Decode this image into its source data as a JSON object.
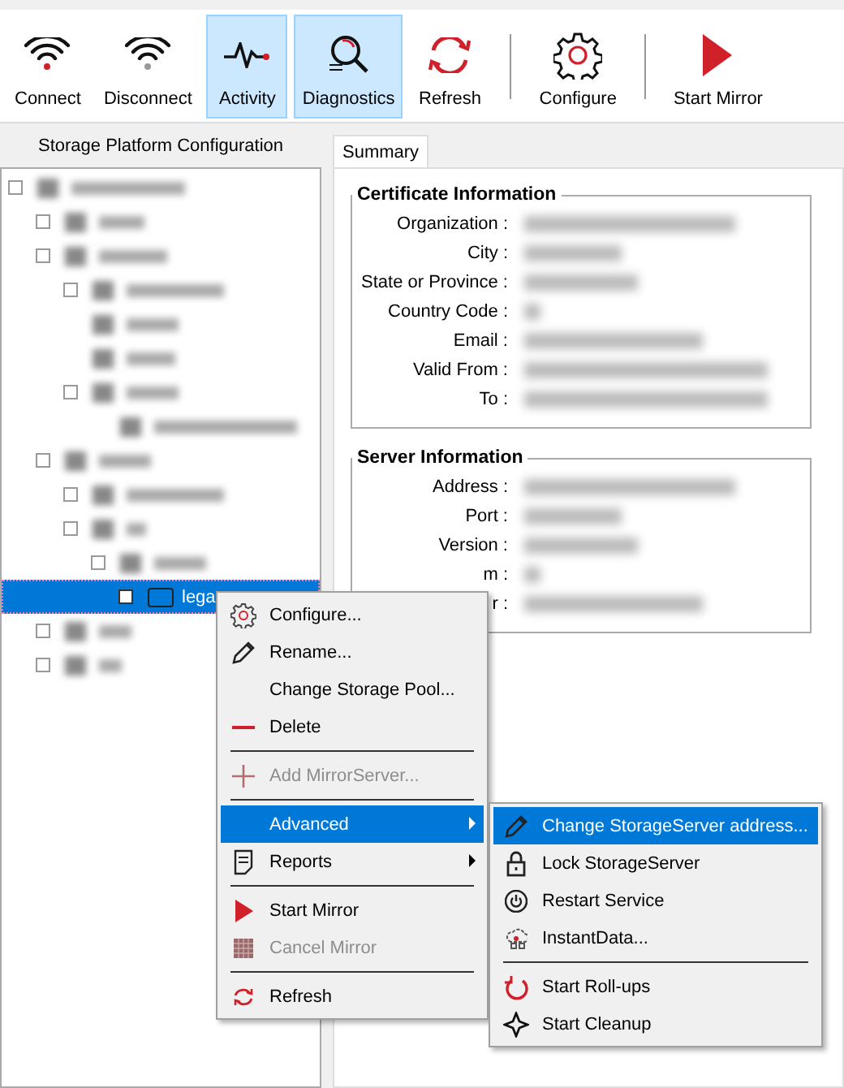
{
  "toolbar": [
    {
      "kind": "button",
      "label": "Connect",
      "selected": false
    },
    {
      "kind": "button",
      "label": "Disconnect",
      "selected": false
    },
    {
      "kind": "button",
      "label": "Activity",
      "selected": true
    },
    {
      "kind": "button",
      "label": "Diagnostics",
      "selected": true
    },
    {
      "kind": "button",
      "label": "Refresh",
      "selected": false
    },
    {
      "kind": "separator"
    },
    {
      "kind": "button",
      "label": "Configure",
      "selected": false
    },
    {
      "kind": "separator"
    },
    {
      "kind": "button",
      "label": "Start Mirror",
      "selected": false
    }
  ],
  "left_panel": {
    "title": "Storage Platform Configuration",
    "tree": [
      {
        "blurred": true,
        "expander": true,
        "selected": false,
        "children": [
          {
            "blurred": true,
            "expander": true,
            "selected": false
          },
          {
            "blurred": true,
            "expander": true,
            "selected": false,
            "children": [
              {
                "blurred": true,
                "expander": true,
                "selected": false
              },
              {
                "blurred": true,
                "expander": false,
                "selected": false
              },
              {
                "blurred": true,
                "expander": false,
                "selected": false
              },
              {
                "blurred": true,
                "expander": true,
                "selected": false,
                "children": [
                  {
                    "blurred": true,
                    "expander": false,
                    "selected": false
                  }
                ]
              }
            ]
          },
          {
            "blurred": true,
            "expander": true,
            "selected": false,
            "children": [
              {
                "blurred": true,
                "expander": true,
                "selected": false
              },
              {
                "blurred": true,
                "expander": true,
                "selected": false,
                "children": [
                  {
                    "blurred": true,
                    "expander": true,
                    "selected": false,
                    "children": [
                      {
                        "blurred": false,
                        "expander": true,
                        "selected": true,
                        "label": "lega"
                      }
                    ]
                  }
                ]
              }
            ]
          },
          {
            "blurred": true,
            "expander": true,
            "selected": false
          },
          {
            "blurred": true,
            "expander": true,
            "selected": false
          }
        ]
      }
    ]
  },
  "tabs": [
    {
      "label": "Summary",
      "selected": true
    }
  ],
  "groups": [
    {
      "title": "Certificate Information",
      "fields": [
        "Organization :",
        "City :",
        "State or Province :",
        "Country Code :",
        "Email :",
        "Valid From :",
        "To :"
      ]
    },
    {
      "title": "Server Information",
      "fields": [
        "Address :",
        "Port :",
        "Version :",
        "m :",
        "r :"
      ]
    }
  ],
  "context_menu": [
    {
      "kind": "item",
      "label": "Configure...",
      "disabled": false,
      "selected": false,
      "submenu": false
    },
    {
      "kind": "item",
      "label": "Rename...",
      "disabled": false,
      "selected": false,
      "submenu": false
    },
    {
      "kind": "item",
      "label": "Change Storage Pool...",
      "disabled": false,
      "selected": false,
      "submenu": false
    },
    {
      "kind": "item",
      "label": "Delete",
      "disabled": false,
      "selected": false,
      "submenu": false
    },
    {
      "kind": "separator"
    },
    {
      "kind": "item",
      "label": "Add MirrorServer...",
      "disabled": true,
      "selected": false,
      "submenu": false
    },
    {
      "kind": "separator"
    },
    {
      "kind": "item",
      "label": "Advanced",
      "disabled": false,
      "selected": true,
      "submenu": true
    },
    {
      "kind": "item",
      "label": "Reports",
      "disabled": false,
      "selected": false,
      "submenu": true
    },
    {
      "kind": "separator"
    },
    {
      "kind": "item",
      "label": "Start Mirror",
      "disabled": false,
      "selected": false,
      "submenu": false
    },
    {
      "kind": "item",
      "label": "Cancel Mirror",
      "disabled": true,
      "selected": false,
      "submenu": false
    },
    {
      "kind": "separator"
    },
    {
      "kind": "item",
      "label": "Refresh",
      "disabled": false,
      "selected": false,
      "submenu": false
    }
  ],
  "submenu": [
    {
      "kind": "item",
      "label": "Change StorageServer address...",
      "disabled": false,
      "selected": true,
      "submenu": false
    },
    {
      "kind": "item",
      "label": "Lock StorageServer",
      "disabled": false,
      "selected": false,
      "submenu": false
    },
    {
      "kind": "item",
      "label": "Restart Service",
      "disabled": false,
      "selected": false,
      "submenu": false
    },
    {
      "kind": "item",
      "label": "InstantData...",
      "disabled": false,
      "selected": false,
      "submenu": false
    },
    {
      "kind": "separator"
    },
    {
      "kind": "item",
      "label": "Start Roll-ups",
      "disabled": false,
      "selected": false,
      "submenu": false
    },
    {
      "kind": "item",
      "label": "Start Cleanup",
      "disabled": false,
      "selected": false,
      "submenu": false
    }
  ]
}
